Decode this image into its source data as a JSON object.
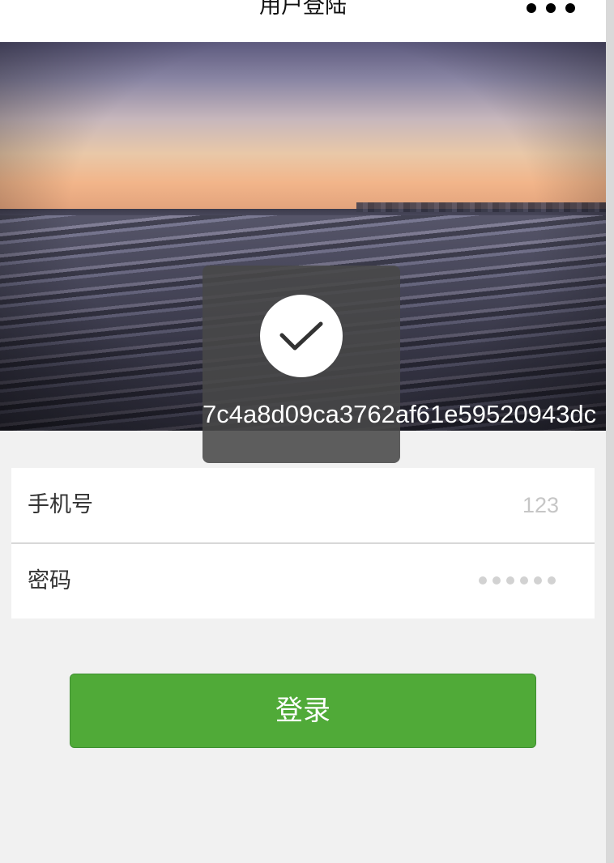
{
  "navbar": {
    "title": "用户登陆",
    "more_icon": "more-dots-icon"
  },
  "banner": {
    "image_subject": "sunset-over-sea"
  },
  "toast": {
    "icon": "checkmark-icon",
    "message": "7c4a8d09ca3762af61e59520943dc"
  },
  "form": {
    "phone": {
      "label": "手机号",
      "placeholder": "123"
    },
    "password": {
      "label": "密码",
      "masked_length": 6
    }
  },
  "login_button": {
    "label": "登录"
  },
  "colors": {
    "primary_green": "#50aa38",
    "background": "#f1f1f1",
    "toast_bg": "#484848"
  }
}
